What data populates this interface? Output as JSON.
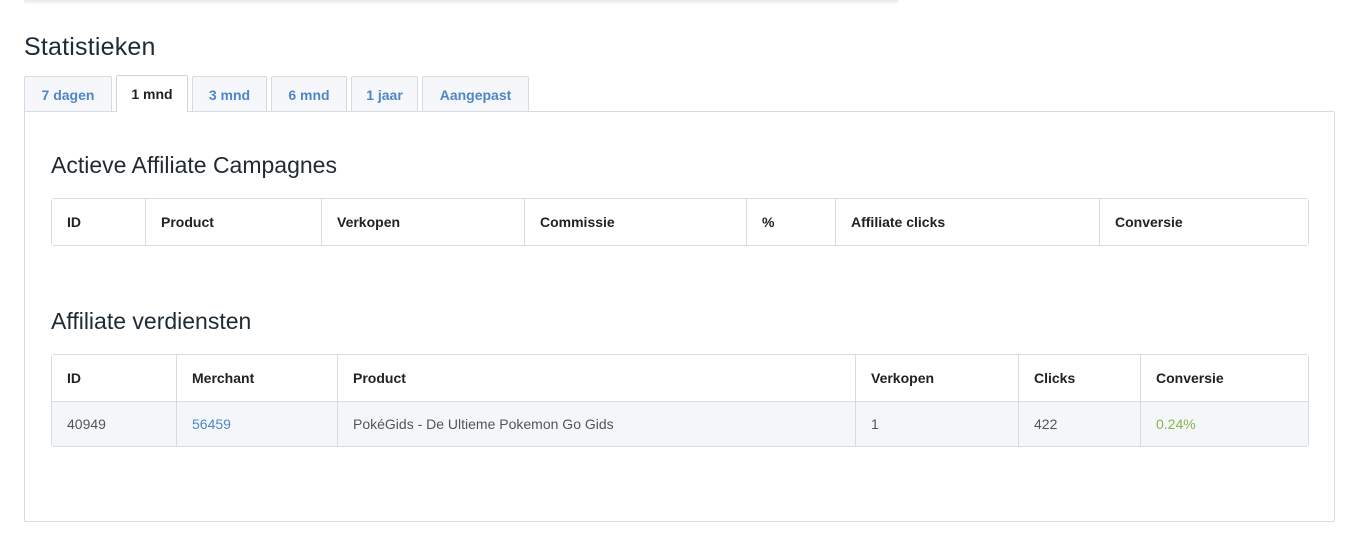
{
  "page": {
    "title": "Statistieken"
  },
  "tabs": [
    {
      "label": "7 dagen",
      "active": false
    },
    {
      "label": "1 mnd",
      "active": true
    },
    {
      "label": "3 mnd",
      "active": false
    },
    {
      "label": "6 mnd",
      "active": false
    },
    {
      "label": "1 jaar",
      "active": false
    },
    {
      "label": "Aangepast",
      "active": false
    }
  ],
  "campaigns": {
    "title": "Actieve Affiliate Campagnes",
    "headers": [
      "ID",
      "Product",
      "Verkopen",
      "Commissie",
      "%",
      "Affiliate clicks",
      "Conversie"
    ],
    "rows": []
  },
  "earnings": {
    "title": "Affiliate verdiensten",
    "headers": [
      "ID",
      "Merchant",
      "Product",
      "Verkopen",
      "Clicks",
      "Conversie"
    ],
    "rows": [
      {
        "id": "40949",
        "merchant": "56459",
        "product": "PokéGids - De Ultieme Pokemon Go Gids",
        "sales": "1",
        "clicks": "422",
        "conversion": "0.24%"
      }
    ]
  },
  "colors": {
    "link": "#4f86c6",
    "positive": "#8ab34a",
    "border": "#d7dce1"
  }
}
